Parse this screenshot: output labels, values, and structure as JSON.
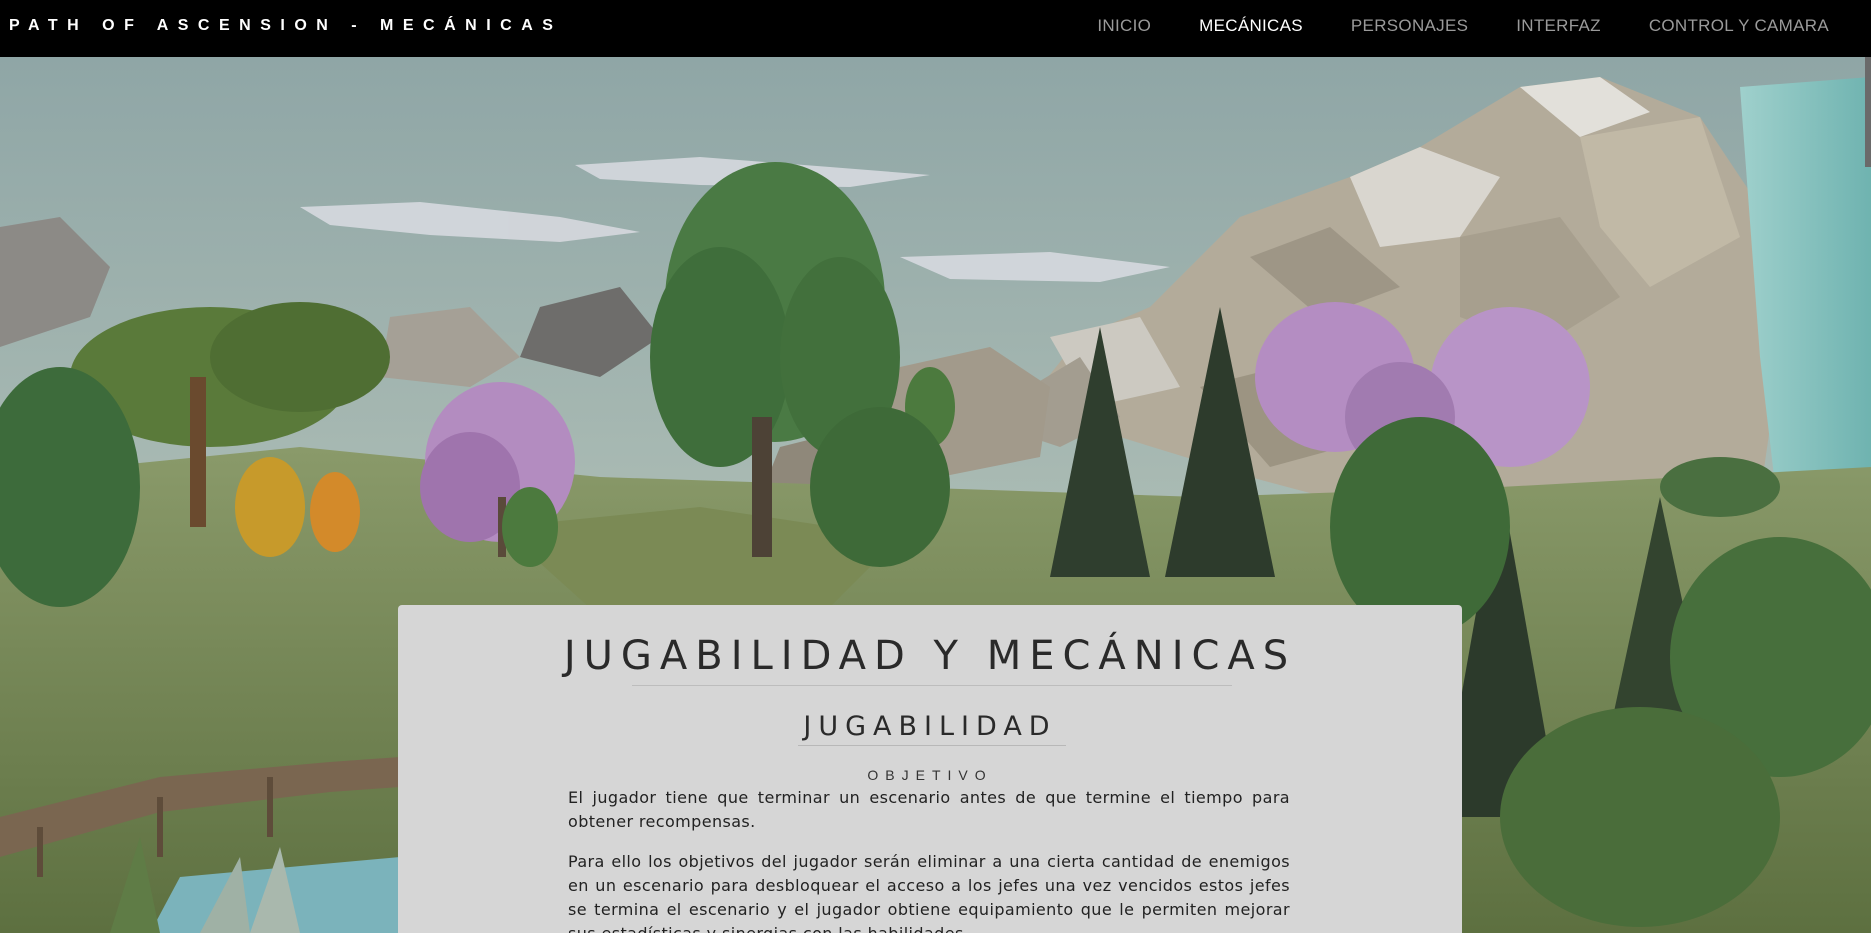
{
  "header": {
    "site_title": "PATH OF ASCENSION - MECÁNICAS",
    "nav": [
      {
        "label": "INICIO",
        "active": false
      },
      {
        "label": "MECÁNICAS",
        "active": true
      },
      {
        "label": "PERSONAJES",
        "active": false
      },
      {
        "label": "INTERFAZ",
        "active": false
      },
      {
        "label": "CONTROL Y CAMARA",
        "active": false
      }
    ]
  },
  "main": {
    "title": "JUGABILIDAD Y MECÁNICAS",
    "section_title": "JUGABILIDAD",
    "subsection_title": "OBJETIVO",
    "paragraphs": [
      "El jugador tiene que terminar un escenario antes de que termine el tiempo para obtener recompensas.",
      "Para ello los objetivos del jugador serán eliminar a una cierta cantidad de enemigos en un escenario para desbloquear el acceso a los jefes una vez vencidos estos jefes se termina el escenario y el jugador obtiene equipamiento que le permiten mejorar sus estadísticas y sinergias con las habilidades."
    ]
  },
  "colors": {
    "nav_background": "#000000",
    "nav_text": "#9a9a9a",
    "nav_active": "#ffffff",
    "card_background": "#d6d6d6"
  }
}
